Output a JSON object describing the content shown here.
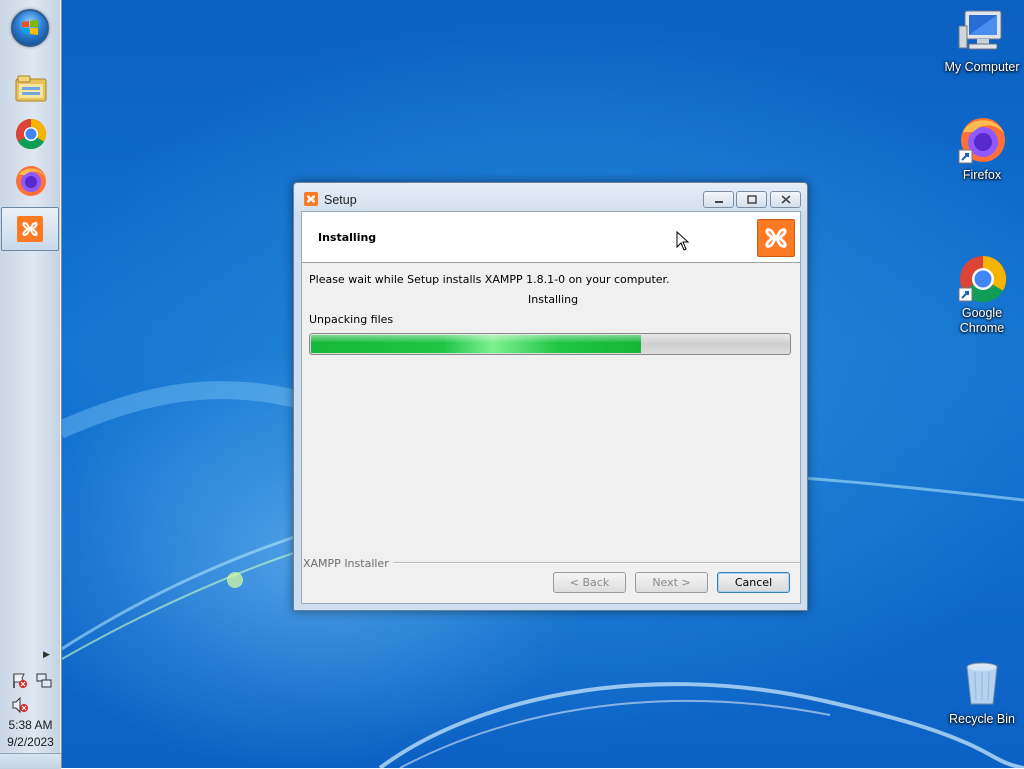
{
  "taskbar": {
    "start_icon": "windows-start-orb",
    "pinned": [
      {
        "name": "file-explorer-icon"
      },
      {
        "name": "google-chrome-icon"
      },
      {
        "name": "firefox-icon"
      },
      {
        "name": "xampp-icon",
        "active": true
      }
    ],
    "tray": {
      "expand_icon": "chevron-right-icon",
      "icons": [
        "action-center-flag-icon",
        "network-icon",
        "volume-muted-icon"
      ],
      "time": "5:38 AM",
      "date": "9/2/2023"
    }
  },
  "desktop_icons": [
    {
      "label": "My Computer",
      "icon": "computer-icon"
    },
    {
      "label": "Firefox",
      "icon": "firefox-shortcut-icon"
    },
    {
      "label": "Google\nChrome",
      "icon": "chrome-shortcut-icon"
    },
    {
      "label": "Recycle Bin",
      "icon": "recycle-bin-icon"
    }
  ],
  "window": {
    "title": "Setup",
    "title_icon": "xampp-small-icon",
    "controls": [
      "minimize",
      "restore",
      "close"
    ],
    "header_title": "Installing",
    "header_logo": "xampp-logo",
    "message": "Please wait while Setup installs XAMPP 1.8.1-0 on your computer.",
    "status": "Installing",
    "detail": "Unpacking files",
    "progress_fraction": 0.69,
    "group_label": "XAMPP Installer",
    "buttons": {
      "back": "< Back",
      "next": "Next >",
      "cancel": "Cancel"
    }
  },
  "colors": {
    "xampp_orange": "#fb7a24",
    "progress_green": "#1fc546",
    "desktop_blue": "#1374d2"
  }
}
